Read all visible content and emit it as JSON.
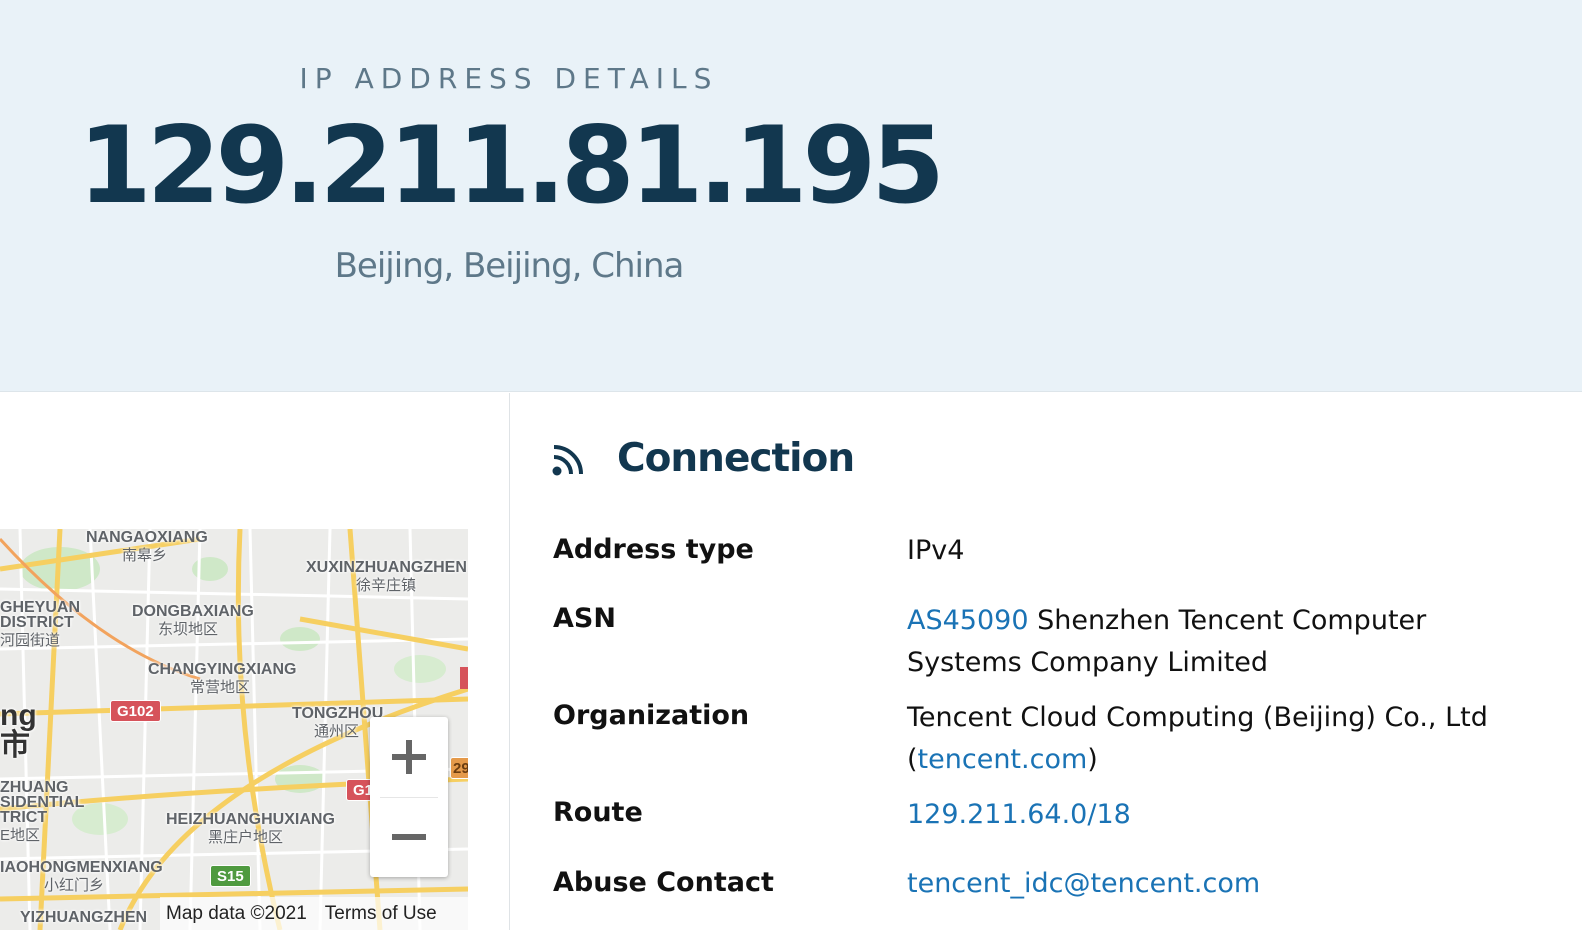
{
  "hero": {
    "eyebrow": "IP ADDRESS DETAILS",
    "ip": "129.211.81.195",
    "location": "Beijing, Beijing, China"
  },
  "connection": {
    "title": "Connection",
    "icon": "signal-icon",
    "rows": [
      {
        "label": "Address type",
        "value": "IPv4"
      },
      {
        "label": "ASN",
        "link": "AS45090",
        "text": " Shenzhen Tencent Computer Systems Company Limited"
      },
      {
        "label": "Organization",
        "text_before": "Tencent Cloud Computing (Beijing) Co., Ltd (",
        "link": "tencent.com",
        "text_after": ")"
      },
      {
        "label": "Route",
        "link": "129.211.64.0/18"
      },
      {
        "label": "Abuse Contact",
        "link": "tencent_idc@tencent.com"
      }
    ]
  },
  "map": {
    "labels": [
      {
        "main": "NANGAOXIANG",
        "sub": "南皋乡"
      },
      {
        "main": "XUXINZHUANGZHEN",
        "sub": "徐辛庄镇"
      },
      {
        "main": "GHEYUAN",
        "sub": ""
      },
      {
        "main": "DISTRICT",
        "sub": "河园街道"
      },
      {
        "main": "DONGBAXIANG",
        "sub": "东坝地区"
      },
      {
        "main": "CHANGYINGXIANG",
        "sub": "常营地区"
      },
      {
        "main": "TONGZHOU",
        "sub": "通州区"
      },
      {
        "main": "ng",
        "sub": "市"
      },
      {
        "main": "ZHUANG",
        "sub": ""
      },
      {
        "main": "SIDENTIAL",
        "sub": ""
      },
      {
        "main": "TRICT",
        "sub": "E地区"
      },
      {
        "main": "HEIZHUANGHUXIANG",
        "sub": "黑庄户地区"
      },
      {
        "main": "IAOHONGMENXIANG",
        "sub": "小红门乡"
      },
      {
        "main": "YIZHUANGZHEN",
        "sub": ""
      }
    ],
    "shields": [
      {
        "text": "G102",
        "color": "#d6535b"
      },
      {
        "text": "S15",
        "color": "#4f9a3f"
      },
      {
        "text": "G1",
        "color": "#d6535b"
      },
      {
        "text": "29",
        "color": "#e59a4a"
      }
    ],
    "footer_data": "Map data ©2021",
    "footer_terms": "Terms of Use",
    "zoom_in_icon": "plus-icon",
    "zoom_out_icon": "minus-icon"
  }
}
